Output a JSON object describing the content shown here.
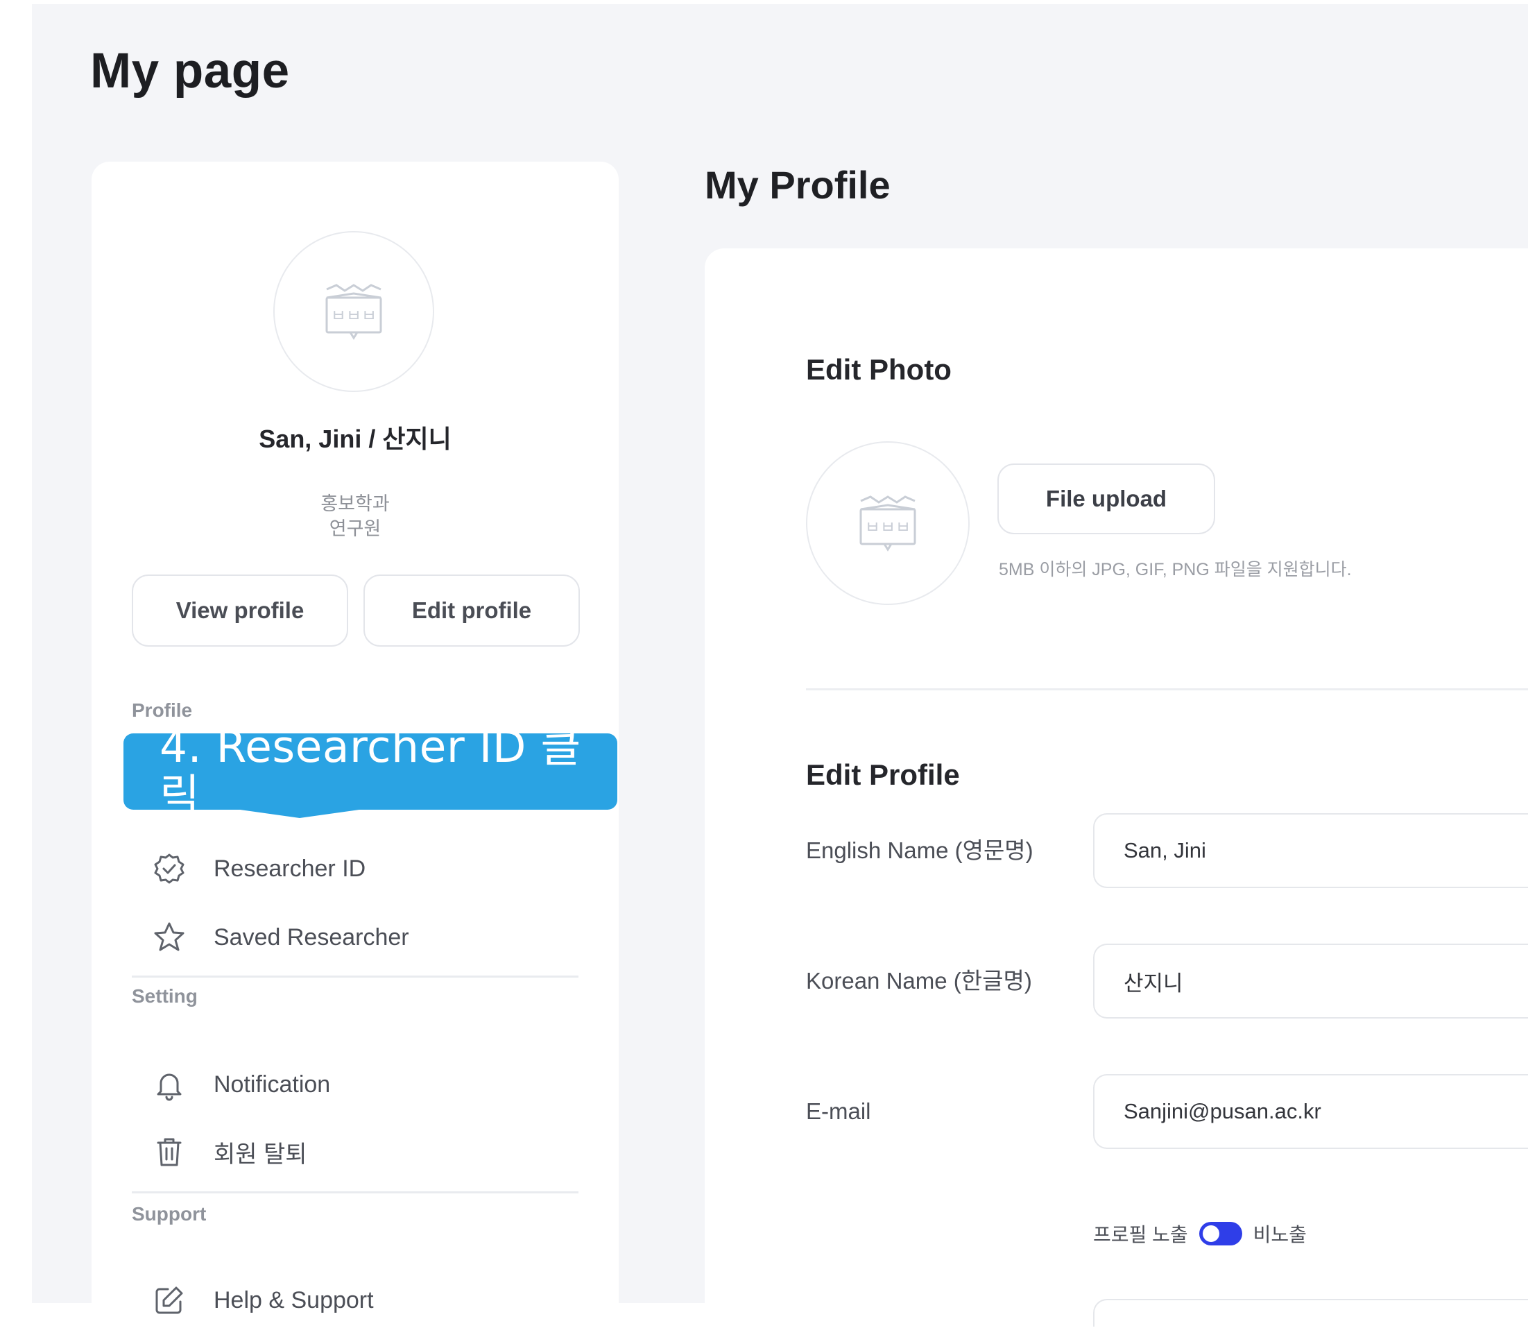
{
  "page": {
    "title": "My page"
  },
  "sidebar": {
    "user": {
      "name": "San, Jini / 산지니",
      "department": "홍보학과",
      "role": "연구원",
      "avatar_icon": "university-logo-icon"
    },
    "buttons": {
      "view_profile": "View profile",
      "edit_profile": "Edit profile"
    },
    "sections": [
      {
        "label": "Profile",
        "items": [
          {
            "label": "Researcher ID",
            "icon": "verified-badge-icon"
          },
          {
            "label": "Saved Researcher",
            "icon": "star-icon"
          }
        ]
      },
      {
        "label": "Setting",
        "items": [
          {
            "label": "Notification",
            "icon": "bell-icon"
          },
          {
            "label": "회원 탈퇴",
            "icon": "trash-icon"
          }
        ]
      },
      {
        "label": "Support",
        "items": [
          {
            "label": "Help & Support",
            "icon": "edit-icon"
          }
        ]
      }
    ]
  },
  "callout": {
    "text": "4. Researcher ID 클릭",
    "color": "#2aa3e3"
  },
  "main": {
    "title": "My Profile",
    "edit_photo": {
      "title": "Edit Photo",
      "upload_label": "File upload",
      "hint": "5MB 이하의 JPG, GIF, PNG 파일을 지원합니다."
    },
    "edit_profile": {
      "title": "Edit Profile",
      "fields": [
        {
          "label": "English Name (영문명)",
          "value": "San, Jini"
        },
        {
          "label": "Korean Name (한글명)",
          "value": "산지니"
        },
        {
          "label": "E-mail",
          "value": "Sanjini@pusan.ac.kr"
        }
      ],
      "visibility": {
        "left_label": "프로필 노출",
        "right_label": "비노출",
        "toggle_color": "#2f3ee8"
      }
    }
  },
  "colors": {
    "background": "#f4f5f8",
    "card": "#ffffff",
    "accent": "#2f3ee8"
  }
}
